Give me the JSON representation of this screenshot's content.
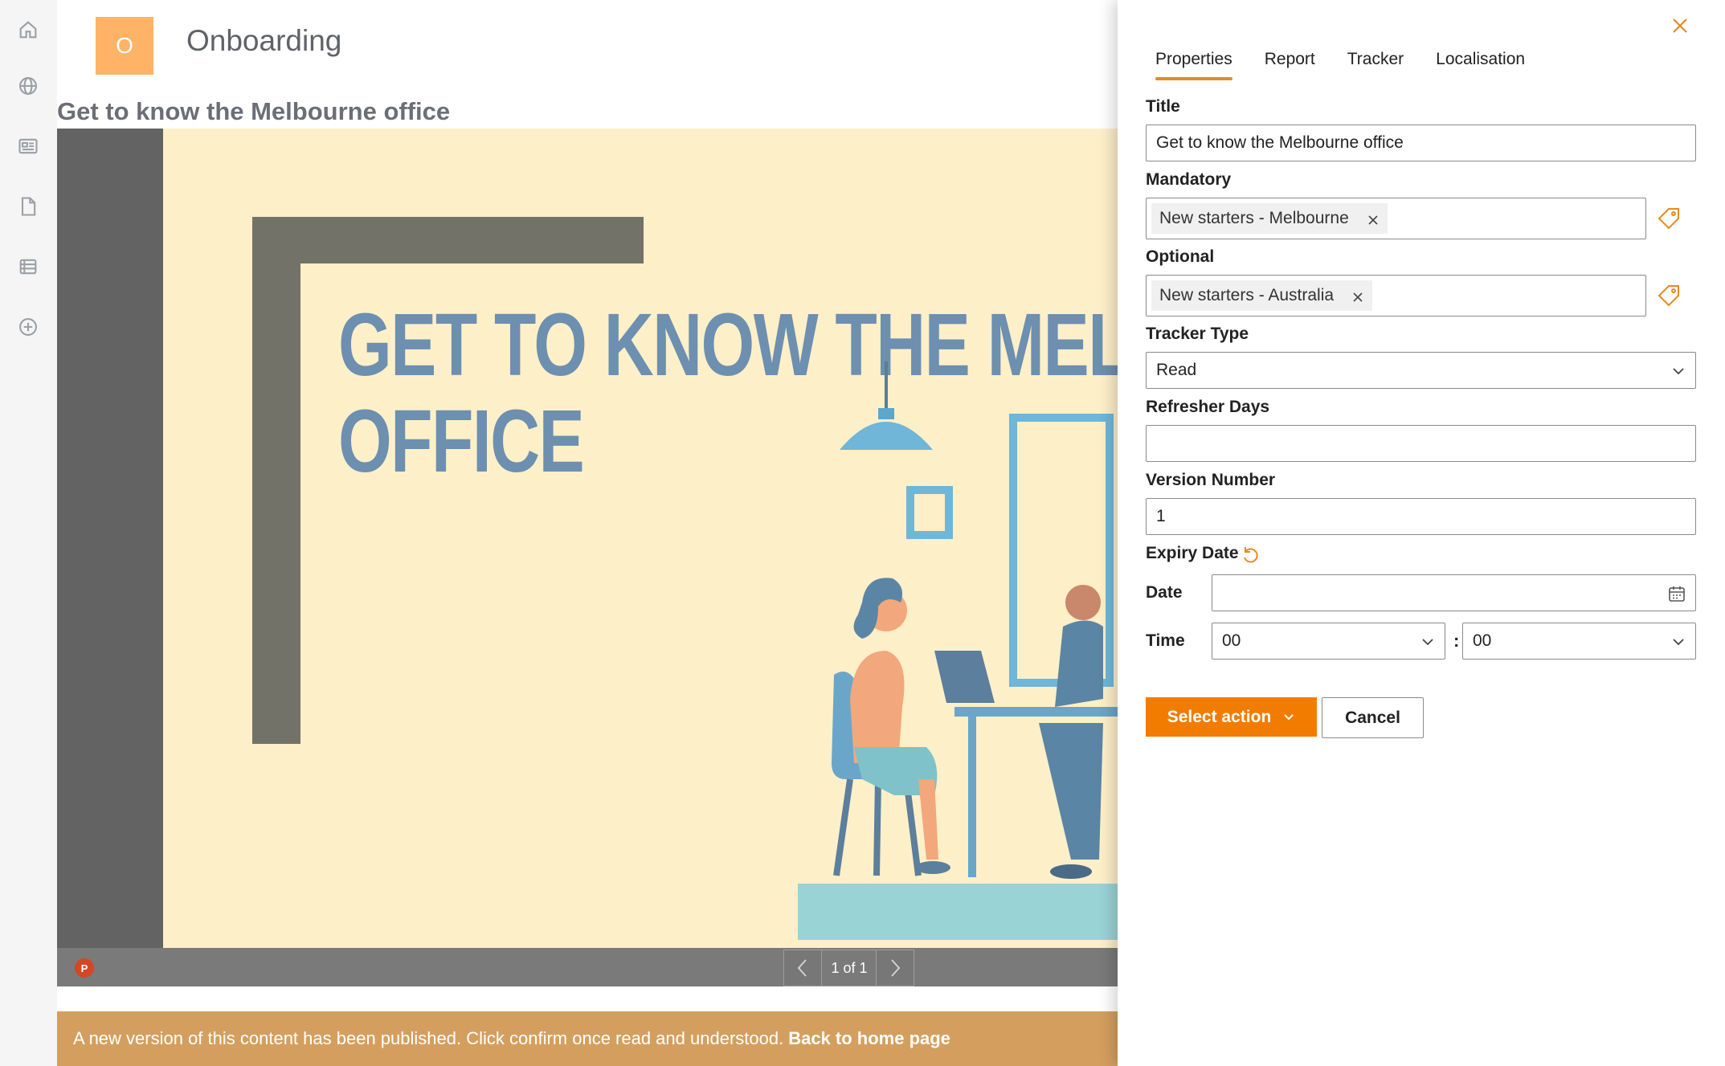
{
  "site": {
    "logo_letter": "O",
    "title": "Onboarding"
  },
  "page": {
    "title": "Get to know the Melbourne office"
  },
  "rail": {
    "icons": [
      "home-icon",
      "globe-icon",
      "news-icon",
      "document-icon",
      "list-icon",
      "add-circle-icon"
    ]
  },
  "viewer": {
    "slide_heading_line1": "GET TO KNOW THE MEL",
    "slide_heading_line2": "OFFICE",
    "file_badge": "P",
    "pager": "1 of 1"
  },
  "notice": {
    "text": "A new version of this content has been published. Click confirm once read and understood.",
    "link": "Back to home page"
  },
  "panel": {
    "tabs": [
      {
        "label": "Properties",
        "active": true
      },
      {
        "label": "Report",
        "active": false
      },
      {
        "label": "Tracker",
        "active": false
      },
      {
        "label": "Localisation",
        "active": false
      }
    ],
    "title_label": "Title",
    "title_value": "Get to know the Melbourne office",
    "mandatory_label": "Mandatory",
    "mandatory_tags": [
      "New starters - Melbourne"
    ],
    "optional_label": "Optional",
    "optional_tags": [
      "New starters - Australia"
    ],
    "tracker_type_label": "Tracker Type",
    "tracker_type_value": "Read",
    "refresher_days_label": "Refresher Days",
    "refresher_days_value": "",
    "version_number_label": "Version Number",
    "version_number_value": "1",
    "expiry_date_label": "Expiry Date",
    "date_label": "Date",
    "date_value": "",
    "time_label": "Time",
    "hour_value": "00",
    "time_separator": ":",
    "minute_value": "00",
    "select_action_label": "Select action",
    "cancel_label": "Cancel"
  },
  "colors": {
    "accent": "#f27c00",
    "logo_bg": "#ffb366",
    "notice_bg": "#d49f5e",
    "slide_bg": "#fdefc8",
    "slide_text": "#6d8fb0"
  }
}
